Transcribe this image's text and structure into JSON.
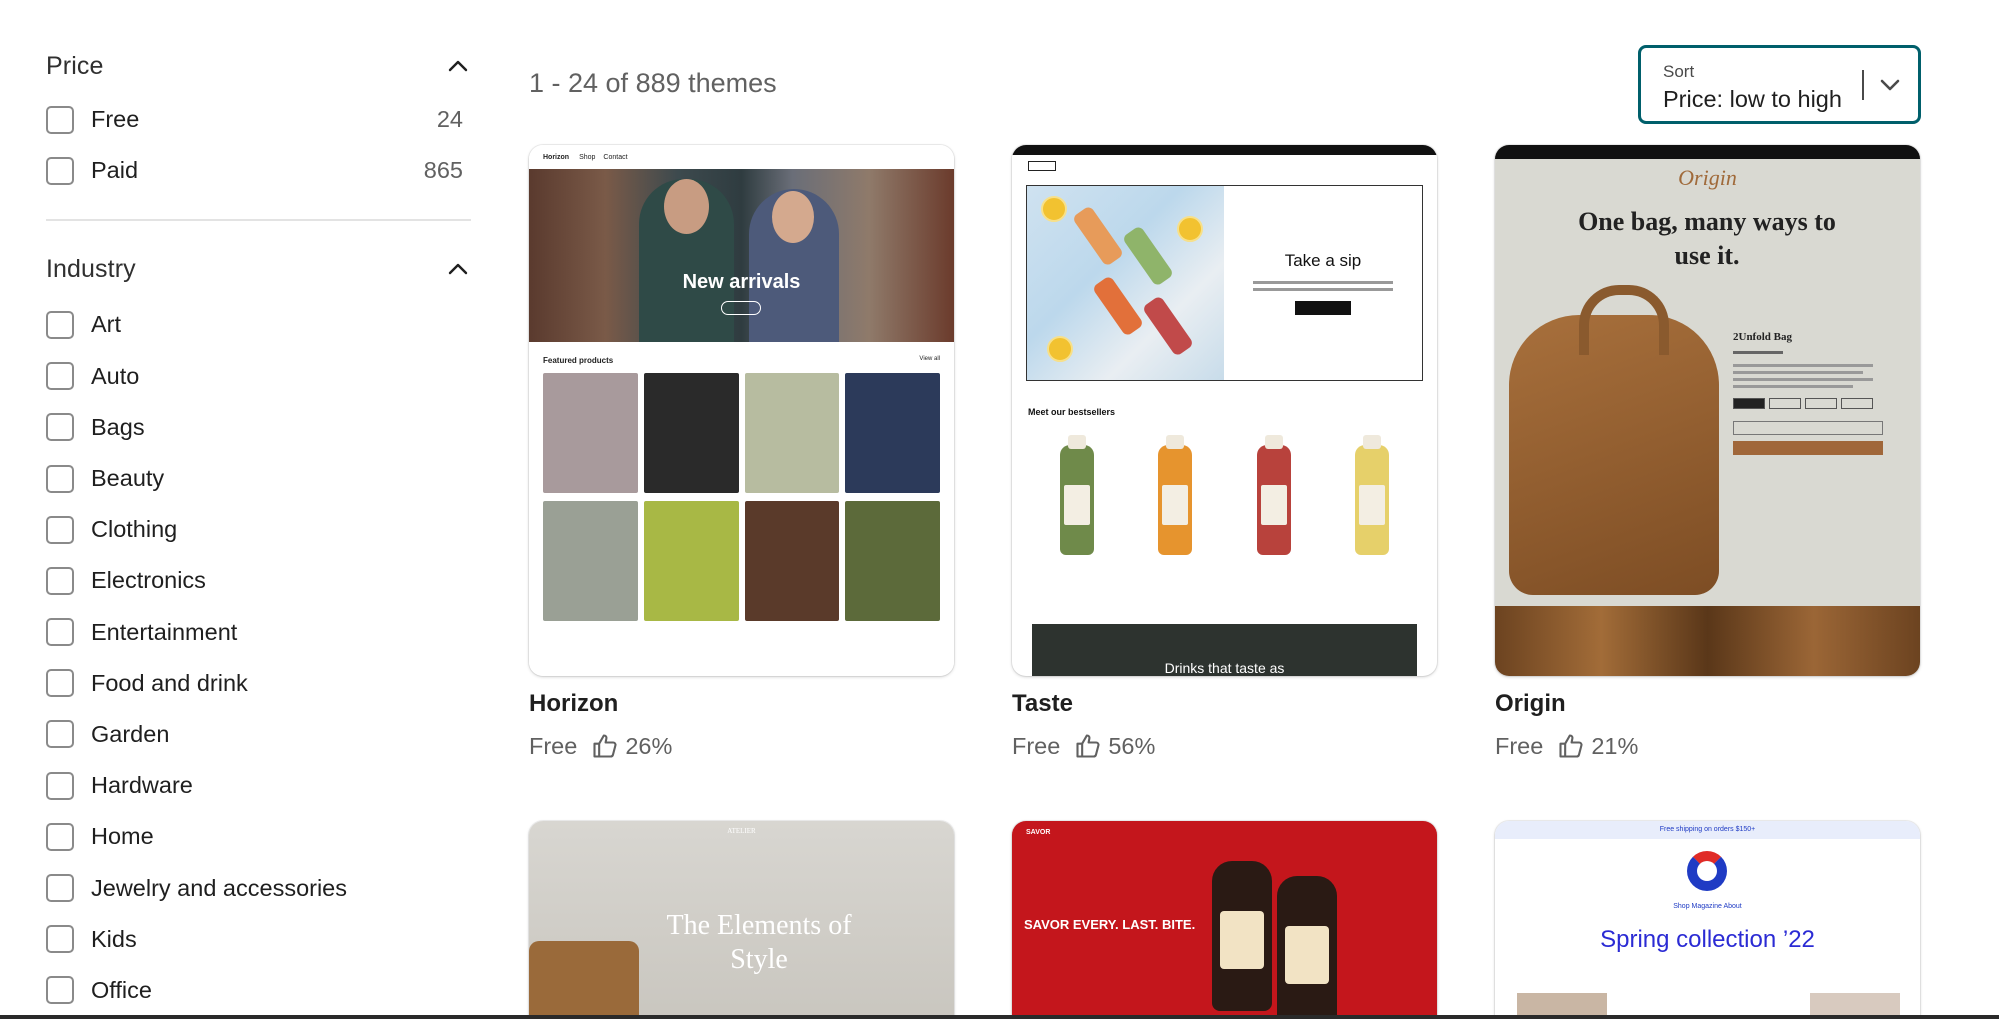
{
  "filters": {
    "price": {
      "title": "Price",
      "options": [
        {
          "label": "Free",
          "count": "24"
        },
        {
          "label": "Paid",
          "count": "865"
        }
      ]
    },
    "industry": {
      "title": "Industry",
      "options": [
        {
          "label": "Art"
        },
        {
          "label": "Auto"
        },
        {
          "label": "Bags"
        },
        {
          "label": "Beauty"
        },
        {
          "label": "Clothing"
        },
        {
          "label": "Electronics"
        },
        {
          "label": "Entertainment"
        },
        {
          "label": "Food and drink"
        },
        {
          "label": "Garden"
        },
        {
          "label": "Hardware"
        },
        {
          "label": "Home"
        },
        {
          "label": "Jewelry and accessories"
        },
        {
          "label": "Kids"
        },
        {
          "label": "Office"
        }
      ]
    }
  },
  "results": {
    "summary": "1 - 24 of 889 themes"
  },
  "sort": {
    "caption": "Sort",
    "value": "Price: low to high"
  },
  "themes": [
    {
      "name": "Horizon",
      "price": "Free",
      "rating": "26%",
      "preview": {
        "hero": "New arrivals",
        "section": "Featured products",
        "link": "View all",
        "nav": [
          "Horizon",
          "Shop",
          "Contact"
        ]
      }
    },
    {
      "name": "Taste",
      "price": "Free",
      "rating": "56%",
      "preview": {
        "hero": "Take a sip",
        "section": "Meet our bestsellers",
        "footer": "Drinks that taste as"
      }
    },
    {
      "name": "Origin",
      "price": "Free",
      "rating": "21%",
      "preview": {
        "logo": "Origin",
        "hero": "One bag, many ways to use it.",
        "product": "2Unfold Bag"
      }
    },
    {
      "preview": {
        "logo": "ATELIER",
        "hero": "The Elements of Style"
      }
    },
    {
      "preview": {
        "logo": "SAVOR",
        "hero": "SAVOR EVERY. LAST. BITE."
      }
    },
    {
      "preview": {
        "banner": "Free shipping on orders $150+",
        "hero": "Spring collection ’22",
        "links": "Shop   Magazine   About"
      }
    }
  ],
  "icons": {
    "chevron_up": "chevron-up-icon",
    "chevron_down": "chevron-down-icon",
    "thumbs_up": "thumbs-up-icon"
  },
  "colors": {
    "sort_border": "#005f6b",
    "muted_text": "#616161"
  }
}
